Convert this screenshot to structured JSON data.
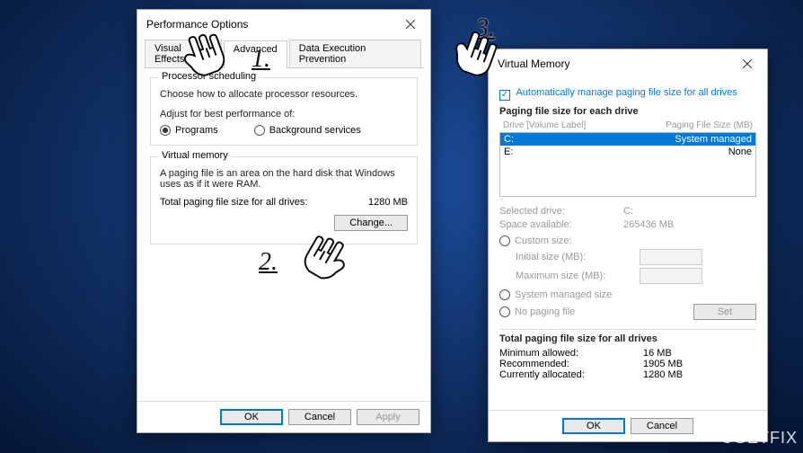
{
  "perf": {
    "title": "Performance Options",
    "tabs": [
      "Visual Effects",
      "Advanced",
      "Data Execution Prevention"
    ],
    "active_tab": "Advanced",
    "proc": {
      "title": "Processor scheduling",
      "desc": "Choose how to allocate processor resources.",
      "adjust": "Adjust for best performance of:",
      "programs": "Programs",
      "bgservices": "Background services"
    },
    "vm": {
      "title": "Virtual memory",
      "desc": "A paging file is an area on the hard disk that Windows uses as if it were RAM.",
      "totalLabel": "Total paging file size for all drives:",
      "totalValue": "1280 MB",
      "change": "Change..."
    },
    "ok": "OK",
    "cancel": "Cancel",
    "apply": "Apply"
  },
  "vmd": {
    "title": "Virtual Memory",
    "auto": "Automatically manage paging file size for all drives",
    "listTitle": "Paging file size for each drive",
    "hdrDrive": "Drive  [Volume Label]",
    "hdrSize": "Paging File Size (MB)",
    "rows": [
      {
        "drive": "C:",
        "size": "System managed",
        "hl": true
      },
      {
        "drive": "E:",
        "size": "None",
        "hl": false
      }
    ],
    "seldrive_l": "Selected drive:",
    "seldrive_v": "C:",
    "space_l": "Space available:",
    "space_v": "265436 MB",
    "custom": "Custom size:",
    "init": "Initial size (MB):",
    "max": "Maximum size (MB):",
    "sys": "System managed size",
    "nop": "No paging file",
    "set": "Set",
    "totalTitle": "Total paging file size for all drives",
    "min_l": "Minimum allowed:",
    "min_v": "16 MB",
    "rec_l": "Recommended:",
    "rec_v": "1905 MB",
    "cur_l": "Currently allocated:",
    "cur_v": "1280 MB",
    "ok": "OK",
    "cancel": "Cancel"
  },
  "annot": {
    "a1": "1.",
    "a2": "2.",
    "a3": "3."
  },
  "watermark": "UGETFIX"
}
